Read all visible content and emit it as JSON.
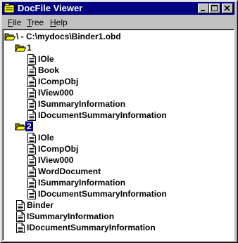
{
  "window": {
    "title": "DocFile Viewer",
    "title_bar_color": "#000080",
    "controls": [
      "minimize-icon",
      "maximize-icon",
      "close-icon"
    ]
  },
  "menu": {
    "file": {
      "mnemonic": "F",
      "rest": "ile"
    },
    "tree": {
      "mnemonic": "T",
      "rest": "ree"
    },
    "help": {
      "mnemonic": "H",
      "rest": "elp"
    }
  },
  "tree": {
    "root": {
      "label": "\\ - C:\\mydocs\\Binder1.obd",
      "icon": "open-folder-icon"
    },
    "folder1": {
      "label": "1",
      "icon": "open-folder-icon",
      "items": [
        "IOle",
        "Book",
        "ICompObj",
        "IView000",
        "ISummaryInformation",
        "IDocumentSummaryInformation"
      ]
    },
    "folder2": {
      "label": "2",
      "icon": "open-folder-icon",
      "selected": true,
      "items": [
        "IOle",
        "ICompObj",
        "IView000",
        "WordDocument",
        "ISummaryInformation",
        "IDocumentSummaryInformation"
      ]
    },
    "root_items": [
      "Binder",
      "ISummaryInformation",
      "IDocumentSummaryInformation"
    ],
    "document_icon": "document-icon",
    "selection_color": "#000080"
  }
}
